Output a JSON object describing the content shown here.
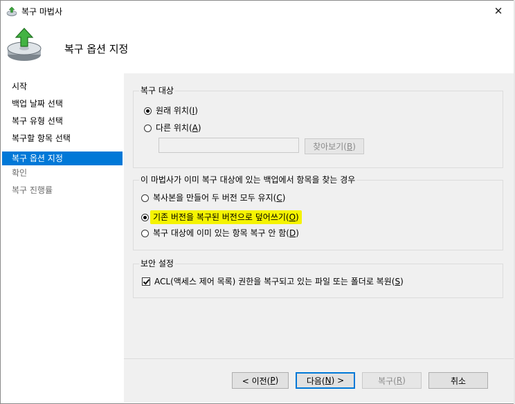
{
  "window": {
    "title": "복구 마법사",
    "close_glyph": "✕"
  },
  "header": {
    "title": "복구 옵션 지정",
    "icon": "restore-disk-icon"
  },
  "nav": {
    "items": [
      {
        "label": "시작",
        "state": "normal"
      },
      {
        "label": "백업 날짜 선택",
        "state": "normal"
      },
      {
        "label": "복구 유형 선택",
        "state": "normal"
      },
      {
        "label": "복구할 항목 선택",
        "state": "normal"
      },
      {
        "label": "복구 옵션 지정",
        "state": "active"
      },
      {
        "label": "확인",
        "state": "disabled"
      },
      {
        "label": "복구 진행률",
        "state": "disabled"
      }
    ]
  },
  "recovery_target": {
    "legend": "복구 대상",
    "original_location": {
      "text": "원래 위치(",
      "key": "I",
      "suffix": ")",
      "checked": true
    },
    "other_location": {
      "text": "다른 위치(",
      "key": "A",
      "suffix": ")",
      "checked": false
    },
    "path_value": "",
    "browse_button": {
      "text": "찾아보기(",
      "key": "B",
      "suffix": ")"
    }
  },
  "conflict": {
    "legend": "이 마법사가 이미 복구 대상에 있는 백업에서 항목을 찾는 경우",
    "option_copy": {
      "text": "복사본을 만들어 두 버전 모두 유지(",
      "key": "C",
      "suffix": ")",
      "checked": false
    },
    "option_overwrite": {
      "text": "기존 버전을 복구된 버전으로 덮어쓰기(",
      "key": "O",
      "suffix": ")",
      "checked": true
    },
    "option_skip": {
      "text": "복구 대상에 이미 있는 항목 복구 안 함(",
      "key": "D",
      "suffix": ")",
      "checked": false
    }
  },
  "security": {
    "legend": "보안 설정",
    "acl": {
      "text": "ACL(액세스 제어 목록) 권한을 복구되고 있는 파일 또는 폴더로 복원(",
      "key": "S",
      "suffix": ")",
      "checked": true
    }
  },
  "footer": {
    "prev": {
      "text": "< 이전(",
      "key": "P",
      "suffix": ")"
    },
    "next": {
      "text": "다음(",
      "key": "N",
      "suffix": ") >"
    },
    "recover": {
      "text": "복구(",
      "key": "R",
      "suffix": ")"
    },
    "cancel": {
      "text": "취소"
    }
  },
  "colors": {
    "accent": "#0078d7",
    "highlight": "#f5f300",
    "panel": "#f0f0f0"
  }
}
